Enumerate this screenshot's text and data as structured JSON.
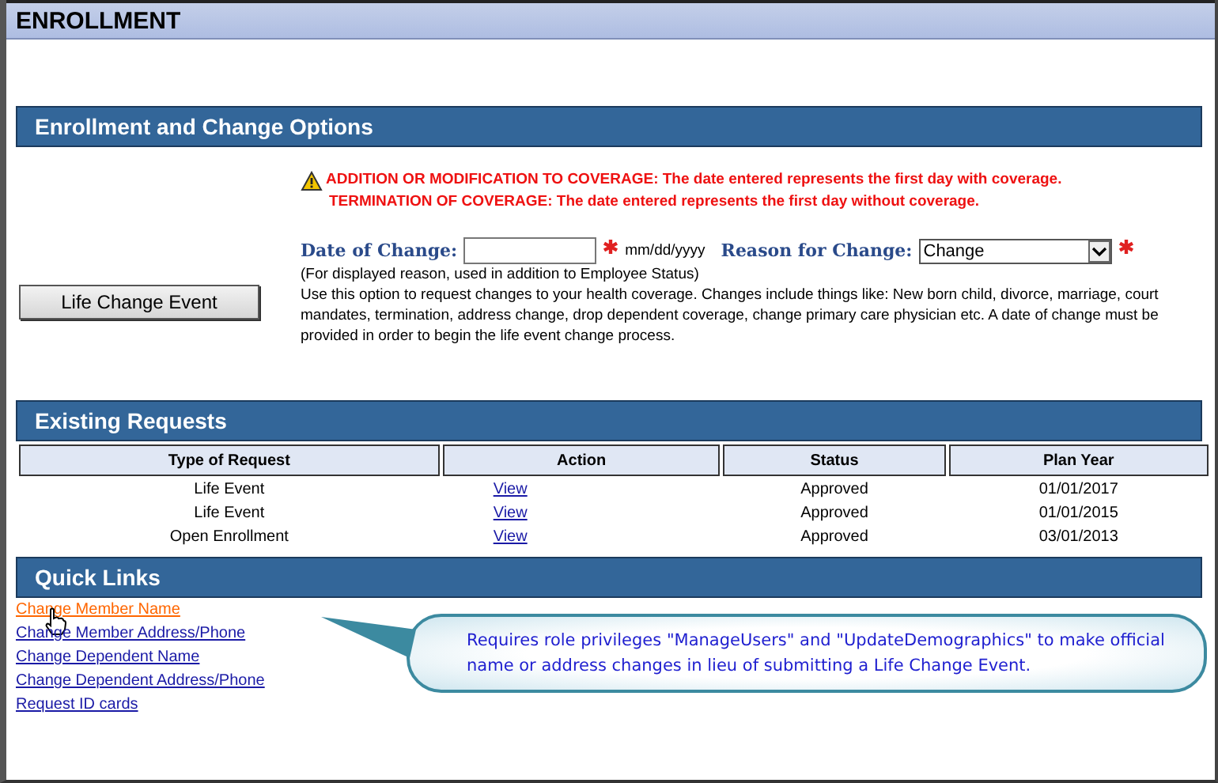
{
  "window": {
    "title": "ENROLLMENT"
  },
  "change_options": {
    "heading": "Enrollment and Change Options",
    "warnings": [
      "ADDITION OR MODIFICATION TO COVERAGE:  The date entered represents the first day with coverage.",
      "TERMINATION OF COVERAGE:  The date entered represents the first day without coverage."
    ],
    "life_change_button": "Life Change Event",
    "date_label": "Date of Change:",
    "date_required": true,
    "date_format": "mm/dd/yyyy",
    "reason_label": "Reason for Change:",
    "reason_value": "Change",
    "reason_required": true,
    "reason_note": "(For displayed reason, used in addition to Employee Status)",
    "description": "Use this option to request changes to your health coverage. Changes include things like: New born child, divorce, marriage, court mandates, termination, address change, drop dependent coverage, change primary care physician etc. A date of change must be provided in order to begin the life event change process."
  },
  "existing_requests": {
    "heading": "Existing Requests",
    "columns": [
      "Type of Request",
      "Action",
      "Status",
      "Plan Year"
    ],
    "rows": [
      {
        "type": "Life Event",
        "action": "View",
        "status": "Approved",
        "plan_year": "01/01/2017"
      },
      {
        "type": "Life Event",
        "action": "View",
        "status": "Approved",
        "plan_year": "01/01/2015"
      },
      {
        "type": "Open Enrollment",
        "action": "View",
        "status": "Approved",
        "plan_year": "03/01/2013"
      }
    ]
  },
  "quick_links": {
    "heading": "Quick Links",
    "links": [
      {
        "label": "Change Member Name",
        "hovered": true
      },
      {
        "label": "Change Member Address/Phone",
        "hovered": false
      },
      {
        "label": "Change Dependent Name",
        "hovered": false
      },
      {
        "label": "Change Dependent Address/Phone",
        "hovered": false
      },
      {
        "label": "Request ID cards",
        "hovered": false
      }
    ]
  },
  "callout": {
    "text": "Requires role privileges \"ManageUsers\" and \"UpdateDemographics\" to make official name or address changes in lieu of submitting a Life Change Event."
  }
}
